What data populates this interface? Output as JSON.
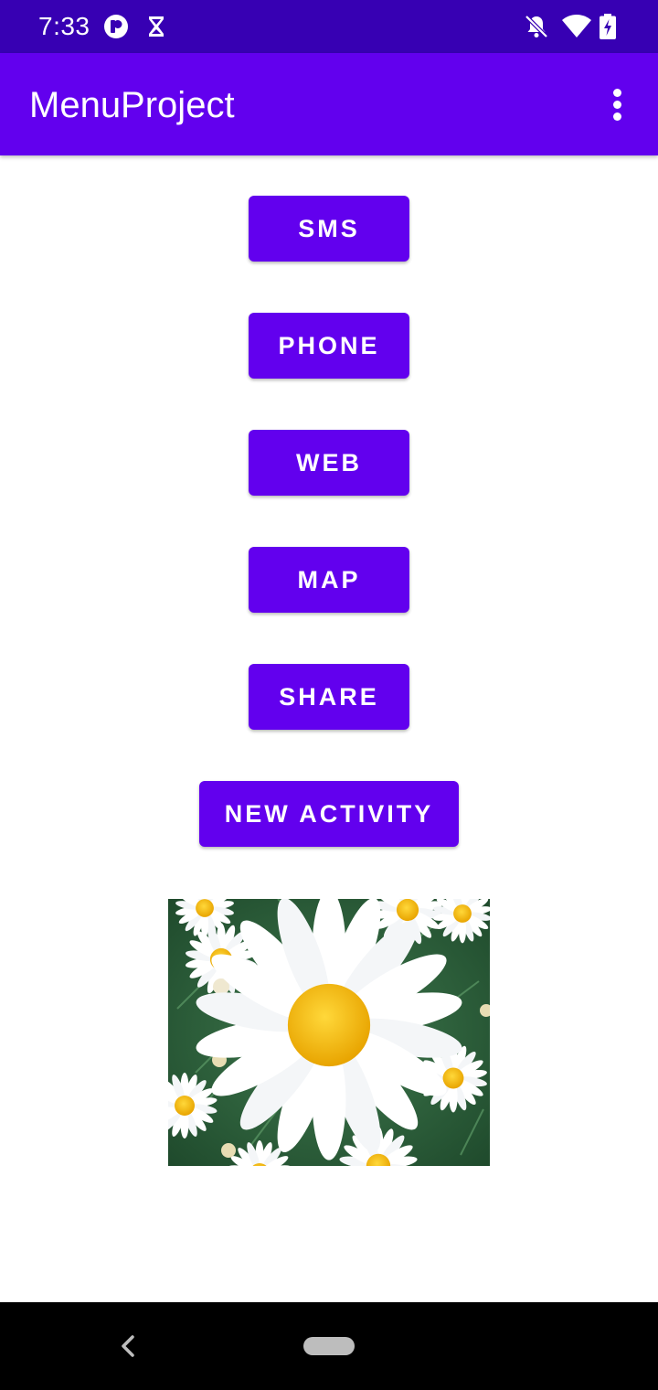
{
  "status_bar": {
    "time": "7:33",
    "icons": [
      "app-notification-icon",
      "hourglass-icon",
      "notifications-off-icon",
      "wifi-icon",
      "battery-charging-icon"
    ]
  },
  "app_bar": {
    "title": "MenuProject",
    "overflow_icon": "more-vert-icon"
  },
  "buttons": {
    "sms": "SMS",
    "phone": "PHONE",
    "web": "WEB",
    "map": "MAP",
    "share": "SHARE",
    "new_activity": "NEW ACTIVITY"
  },
  "image": {
    "subject": "daisy-flowers"
  },
  "nav_bar": {
    "back_icon": "back-chevron-icon",
    "home_icon": "home-pill-icon"
  },
  "colors": {
    "status_bar": "#3700b3",
    "primary": "#6200ee",
    "button_text": "#ffffff",
    "background": "#ffffff",
    "nav_bar": "#000000"
  }
}
